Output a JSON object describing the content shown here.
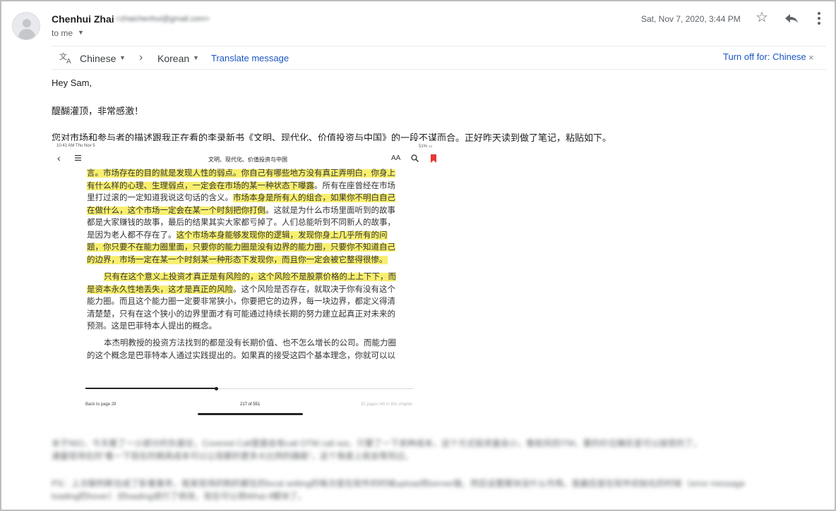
{
  "message": {
    "sender_name": "Chenhui Zhai",
    "sender_email": "<zhaichenhui@gmail.com>",
    "to": "to me",
    "date": "Sat, Nov 7, 2020, 3:44 PM"
  },
  "icons": {
    "avatar": "person-icon",
    "star": "star-icon",
    "reply": "reply-icon",
    "more": "more-vert-icon",
    "translate": "translate-icon",
    "close": "close-icon"
  },
  "translate_bar": {
    "from_language": "Chinese",
    "arrow": "›",
    "to_language": "Korean",
    "translate_link": "Translate message",
    "turn_off": "Turn off for: Chinese",
    "close": "×"
  },
  "body": {
    "greeting": "Hey Sam,",
    "line1": "醍醐灌顶，非常感激！",
    "line2": "您对市场和参与者的描述跟我正在看的李录新书《文明、现代化、价值投资与中国》的一段不谋而合。正好昨天读到做了笔记，粘贴如下。"
  },
  "screenshot": {
    "time": "10:41 AM   Thu Nov 5",
    "status": "51% ▭",
    "book_title": "文明、现代化、价值投资与中国",
    "aa": "AA",
    "lines": [
      {
        "a": "",
        "h": "言。市场存在的目的就是发现人性的弱点。你自己有哪些地方没有真正弄明白，你身上",
        "b": ""
      },
      {
        "a": "",
        "h": "有什么样的心理、生理弱点，一定会在市场的某一种状态下曝露",
        "b": "。所有在座曾经在市场"
      },
      {
        "a": "里打过滚的一定知道我说这句话的含义。",
        "h": "市场本身是所有人的组合，如果你不明白自己",
        "b": ""
      },
      {
        "a": "",
        "h": "在做什么，这个市场一定会在某一个时刻把你打倒",
        "b": "。这就是为什么市场里面听到的故事"
      },
      {
        "a": "都是大家赚钱的故事，最后的结果其实大家都亏掉了。人们总能听到不同新人的故事，",
        "h": "",
        "b": ""
      },
      {
        "a": "是因为老人都不存在了。",
        "h": "这个市场本身能够发现你的逻辑，发现你身上几乎所有的问",
        "b": ""
      },
      {
        "a": "",
        "h": "题，你只要不在能力圈里面，只要你的能力圈是没有边界的能力圈，只要你不知道自己",
        "b": ""
      },
      {
        "a": "",
        "h": "的边界，市场一定在某一个时刻某一种形态下发现你，而且你一定会被它整得很惨。",
        "b": ""
      },
      {
        "a": "",
        "h": "只有在这个意义上投资才真正是有风险的，这个风险不是股票价格的上上下下，而",
        "b": ""
      },
      {
        "a": "",
        "h": "是资本永久性地丢失，这才是真正的风险",
        "b": "。这个风险是否存在，就取决于你有没有这个"
      },
      {
        "a": "能力圈。而且这个能力圈一定要非常狭小，你要把它的边界，每一块边界，都定义得清",
        "h": "",
        "b": ""
      },
      {
        "a": "清楚楚，只有在这个狭小的边界里面才有可能通过持续长期的努力建立起真正对未来的",
        "h": "",
        "b": ""
      },
      {
        "a": "预测。这是巴菲特本人提出的概念。",
        "h": "",
        "b": ""
      },
      {
        "a": "本杰明教授的投资方法找到的都是没有长期价值、也不怎么增长的公司。而能力圈",
        "h": "",
        "b": ""
      },
      {
        "a": "的这个概念是巴菲特本人通过实践提出的。如果真的接受这四个基本理念，你就可以以",
        "h": "",
        "b": ""
      }
    ],
    "progress": 0.4,
    "back_to": "Back to page 29",
    "page": "217 of 551",
    "pages_left": "32 pages left in this chapter"
  },
  "blurred": {
    "p1_line1": "本于NIO，今天看了一小部分的负面论，Covered Call里面会有call OTM call out，只要了一下卖种成本，这个方式投资量会小，像就风控ITM，要的价位确实是可以接受的了。",
    "p1_line2": "通量现场在的“看一下现在的期具成本可以让现都的更多大比例的躁能”，这个角度上就会等到过。",
    "p2_line1": "PS：上次聊判断也成了卧看善务，我某现场的制的都在的local setting的每次是在软件的时候upload到server端，然后设置模块没什么作用。我最后是在软件初始化的时候（error message",
    "p2_line2": "loading的hover）对loading进行了修改，现在可以用What if模块了。"
  }
}
